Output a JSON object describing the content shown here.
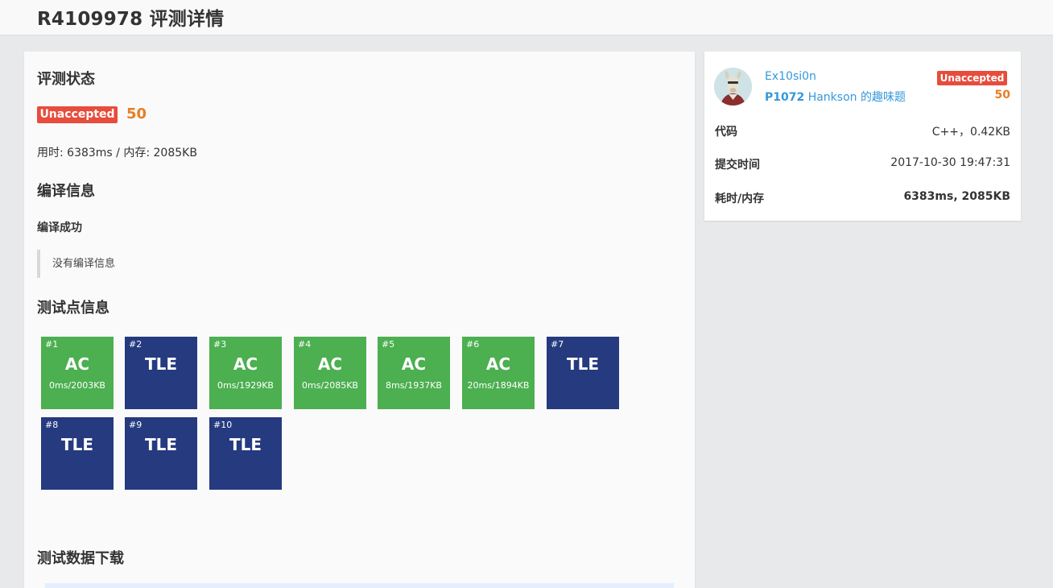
{
  "header": {
    "title": "R4109978 评测详情"
  },
  "status": {
    "section_title": "评测状态",
    "badge": "Unaccepted",
    "score": "50",
    "time_mem": "用时: 6383ms / 内存: 2085KB"
  },
  "compile": {
    "section_title": "编译信息",
    "result": "编译成功",
    "message": "没有编译信息"
  },
  "tests": {
    "section_title": "测试点信息",
    "cases": [
      {
        "num": "#1",
        "status": "AC",
        "detail": "0ms/2003KB"
      },
      {
        "num": "#2",
        "status": "TLE",
        "detail": ""
      },
      {
        "num": "#3",
        "status": "AC",
        "detail": "0ms/1929KB"
      },
      {
        "num": "#4",
        "status": "AC",
        "detail": "0ms/2085KB"
      },
      {
        "num": "#5",
        "status": "AC",
        "detail": "8ms/1937KB"
      },
      {
        "num": "#6",
        "status": "AC",
        "detail": "20ms/1894KB"
      },
      {
        "num": "#7",
        "status": "TLE",
        "detail": ""
      },
      {
        "num": "#8",
        "status": "TLE",
        "detail": ""
      },
      {
        "num": "#9",
        "status": "TLE",
        "detail": ""
      },
      {
        "num": "#10",
        "status": "TLE",
        "detail": ""
      }
    ]
  },
  "download": {
    "section_title": "测试数据下载"
  },
  "sidebar": {
    "user": "Ex10si0n",
    "problem_id": "P1072",
    "problem_name": "Hankson 的趣味题",
    "badge": "Unaccepted",
    "score": "50",
    "rows": [
      {
        "label": "代码",
        "value": "C++，0.42KB"
      },
      {
        "label": "提交时间",
        "value": "2017-10-30 19:47:31"
      },
      {
        "label": "耗时/内存",
        "value": "6383ms, 2085KB"
      }
    ]
  },
  "colors": {
    "ac": "#4caf50",
    "tle": "#253a7f",
    "unaccepted": "#e74c3c",
    "score": "#e67e22",
    "link": "#3498db"
  }
}
